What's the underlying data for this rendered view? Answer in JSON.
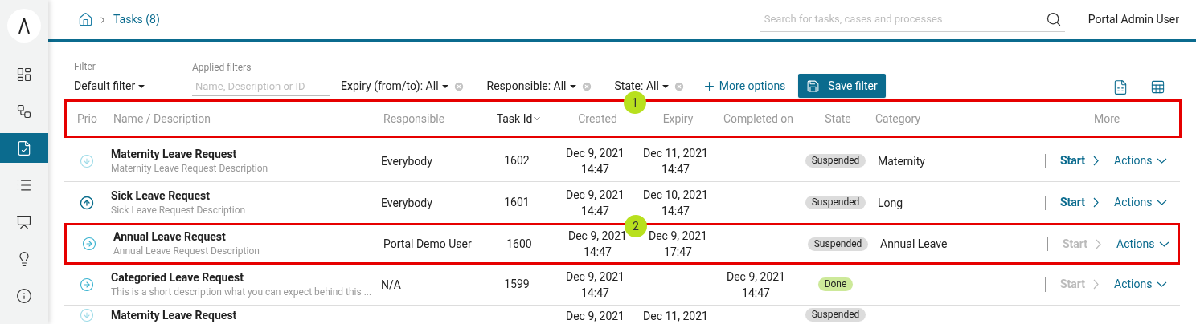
{
  "sidebar": {
    "items": [
      {
        "kind": "dashboard",
        "selected": false
      },
      {
        "kind": "processes",
        "selected": false
      },
      {
        "kind": "tasks",
        "selected": true
      },
      {
        "kind": "cases",
        "selected": false
      },
      {
        "kind": "statistics",
        "selected": false
      },
      {
        "kind": "ideas",
        "selected": false
      },
      {
        "kind": "info",
        "selected": false
      }
    ]
  },
  "breadcrumb": {
    "current": "Tasks (8)"
  },
  "search": {
    "placeholder": "Search for tasks, cases and processes"
  },
  "user": "Portal Admin User",
  "filter": {
    "label": "Filter",
    "value": "Default filter"
  },
  "applied_filters": {
    "label": "Applied filters",
    "placeholder": "Name, Description or ID"
  },
  "chips": [
    "Expiry (from/to): All",
    "Responsible: All",
    "State: All"
  ],
  "more_options": "More options",
  "save_filter": "Save filter",
  "table": {
    "highlighted": true,
    "marker": "1",
    "columns": [
      {
        "label": "Prio",
        "sorted": false
      },
      {
        "label": "Name / Description",
        "sorted": false
      },
      {
        "label": "Responsible",
        "sorted": false
      },
      {
        "label": "Task Id",
        "sorted": true
      },
      {
        "label": "Created",
        "sorted": false
      },
      {
        "label": "Expiry",
        "sorted": false
      },
      {
        "label": "Completed on",
        "sorted": false
      },
      {
        "label": "State",
        "sorted": false
      },
      {
        "label": "Category",
        "sorted": false
      },
      {
        "label": "More",
        "sorted": false
      }
    ],
    "rows": [
      {
        "kind": "low",
        "name": "Maternity Leave Request",
        "description": "Maternity Leave Request Description",
        "responsible": "Everybody",
        "id": "1602",
        "created": [
          "Dec 9, 2021",
          "14:47"
        ],
        "expiry": [
          "Dec 11, 2021",
          "14:47"
        ],
        "state": "Suspended",
        "category": "Maternity",
        "start": "Start",
        "start_disabled": false,
        "actions": "Actions",
        "highlighted": false
      },
      {
        "kind": "high",
        "name": "Sick Leave Request",
        "description": "Sick Leave Request Description",
        "responsible": "Everybody",
        "id": "1601",
        "created": [
          "Dec 9, 2021",
          "14:47"
        ],
        "expiry": [
          "Dec 10, 2021",
          "14:47"
        ],
        "state": "Suspended",
        "category": "Long",
        "start": "Start",
        "start_disabled": false,
        "actions": "Actions",
        "highlighted": false
      },
      {
        "kind": "normal",
        "name": "Annual Leave Request",
        "description": "Annual Leave Request Description",
        "responsible": "Portal Demo User",
        "id": "1600",
        "created": [
          "Dec 9, 2021",
          "14:47"
        ],
        "expiry": [
          "Dec 9, 2021",
          "17:47"
        ],
        "state": "Suspended",
        "category": "Annual Leave",
        "start": "Start",
        "start_disabled": true,
        "actions": "Actions",
        "highlighted": true,
        "marker": "2"
      },
      {
        "kind": "normal",
        "name": "Categoried Leave Request",
        "description": "This is a short description what you can expect behind this ...",
        "responsible": "N/A",
        "id": "1599",
        "created": [
          "Dec 9, 2021",
          "14:47"
        ],
        "completed": [
          "Dec 9, 2021",
          "14:47"
        ],
        "state": "Done",
        "start": "Start",
        "start_disabled": true,
        "actions": "Actions",
        "highlighted": false
      },
      {
        "kind": "low",
        "name": "Maternity Leave Request",
        "created": [
          "Dec 9, 2021"
        ],
        "expiry": [
          "Dec 11, 2021"
        ],
        "state": "Suspended",
        "highlighted": false
      }
    ]
  }
}
